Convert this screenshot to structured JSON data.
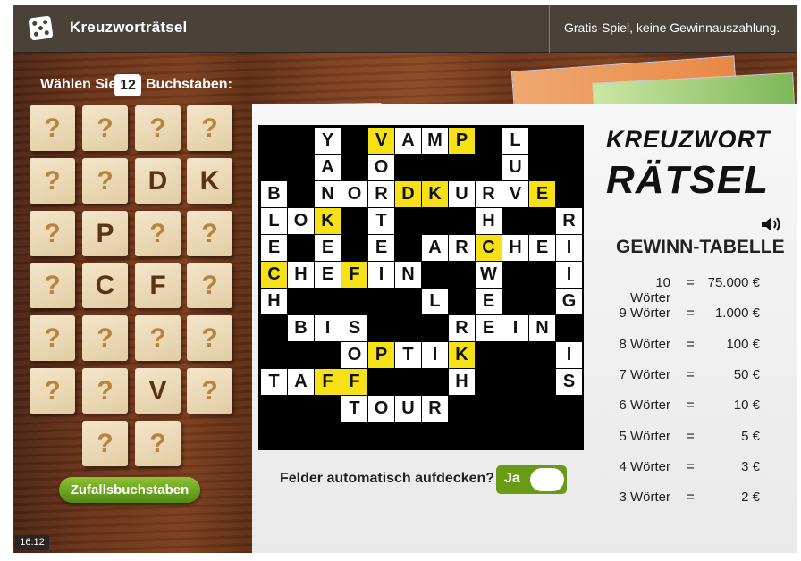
{
  "header": {
    "title": "Kreuzworträtsel",
    "notice": "Gratis-Spiel, keine Gewinnauszahlung."
  },
  "picker": {
    "prefix": "Wählen Sie",
    "count": "12",
    "suffix": "Buchstaben:",
    "tiles": [
      "?",
      "?",
      "?",
      "?",
      "?",
      "?",
      "D",
      "K",
      "?",
      "P",
      "?",
      "?",
      "?",
      "C",
      "F",
      "?",
      "?",
      "?",
      "?",
      "?",
      "?",
      "?",
      "V",
      "?",
      "?",
      "?"
    ],
    "random_button": "Zufallsbuchstaben"
  },
  "clock": "16:12",
  "logo": {
    "line1": "KREUZWORT",
    "line2": "RÄTSEL"
  },
  "prize_table": {
    "title": "GEWINN-TABELLE",
    "rows": [
      {
        "words": "10 Wörter",
        "prize": "75.000 €"
      },
      {
        "words": "9 Wörter",
        "prize": "1.000 €"
      },
      {
        "words": "8 Wörter",
        "prize": "100 €"
      },
      {
        "words": "7 Wörter",
        "prize": "50 €"
      },
      {
        "words": "6 Wörter",
        "prize": "10 €"
      },
      {
        "words": "5 Wörter",
        "prize": "5 €"
      },
      {
        "words": "4 Wörter",
        "prize": "3 €"
      },
      {
        "words": "3 Wörter",
        "prize": "2 €"
      }
    ]
  },
  "auto_reveal": {
    "label": "Felder automatisch aufdecken?",
    "value": "Ja"
  },
  "grid": [
    "..Y.VAMP.L..",
    "..A.O....U..",
    "B.NORDKURVE.",
    "LOK.T...H..R",
    "E.E.E.ARCHEI",
    "CHEFIN..W..I",
    "H.....L.E..G",
    ".BIS...REIN.",
    "...OPTIK...I",
    "TAFF...H...S",
    "...TOUR.....",
    "............"
  ],
  "grid_highlight": [
    "0,4",
    "0,7",
    "2,5",
    "2,6",
    "2,10",
    "3,2",
    "4,8",
    "5,0",
    "5,3",
    "8,4",
    "8,7",
    "9,2",
    "9,3"
  ]
}
